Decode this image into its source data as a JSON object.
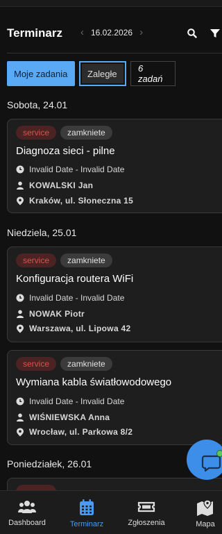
{
  "header": {
    "title": "Terminarz",
    "date": "16.02.2026",
    "prev_icon": "chevron-left-icon",
    "next_icon": "chevron-right-icon",
    "search_icon": "search-icon",
    "filter_icon": "filter-icon"
  },
  "filters": {
    "my_tasks": "Moje zadania",
    "overdue": "Zaległe",
    "count": "6 zadań"
  },
  "days": [
    {
      "label": "Sobota, 24.01",
      "tasks": [
        {
          "type": "service",
          "status": "zamkniete",
          "title": "Diagnoza sieci - pilne",
          "time": "Invalid Date - Invalid Date",
          "person": "KOWALSKI Jan",
          "address": "Kraków, ul. Słoneczna 15"
        }
      ]
    },
    {
      "label": "Niedziela, 25.01",
      "tasks": [
        {
          "type": "service",
          "status": "zamkniete",
          "title": "Konfiguracja routera WiFi",
          "time": "Invalid Date - Invalid Date",
          "person": "NOWAK Piotr",
          "address": "Warszawa, ul. Lipowa 42"
        },
        {
          "type": "service",
          "status": "zamkniete",
          "title": "Wymiana kabla światłowodowego",
          "time": "Invalid Date - Invalid Date",
          "person": "WIŚNIEWSKA Anna",
          "address": "Wrocław, ul. Parkowa 8/2"
        }
      ]
    },
    {
      "label": "Poniedziałek, 26.01",
      "tasks": []
    }
  ],
  "nav": {
    "dashboard": "Dashboard",
    "calendar": "Terminarz",
    "tickets": "Zgłoszenia",
    "map": "Mapa"
  },
  "colors": {
    "accent": "#4a9bf0",
    "service_tag": "#d9534f",
    "background": "#111111"
  }
}
